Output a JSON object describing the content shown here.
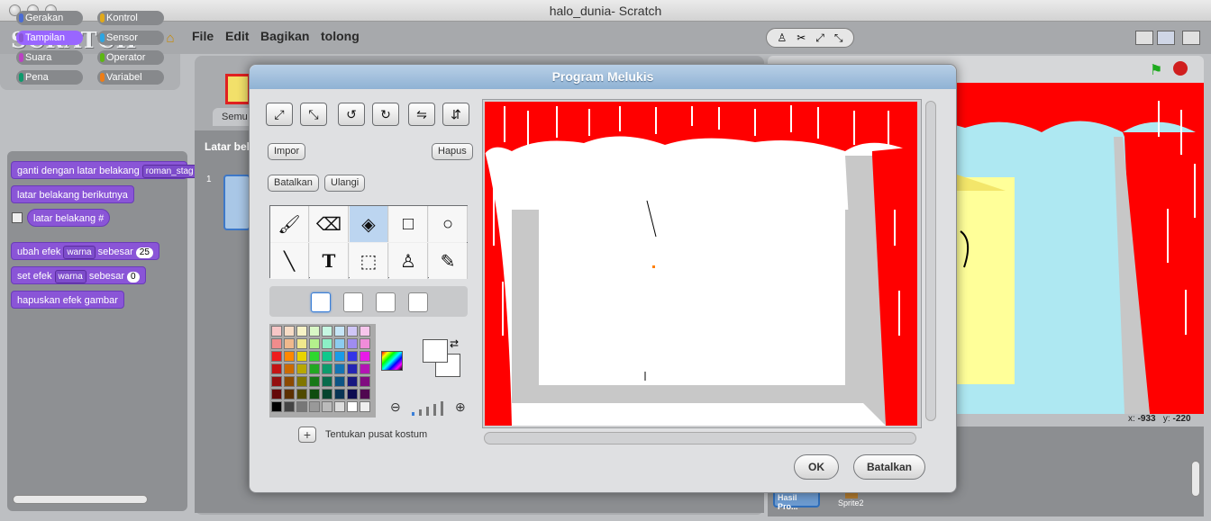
{
  "window": {
    "title": "halo_dunia- Scratch"
  },
  "app": {
    "logo": "SCRATCH",
    "menus": [
      "File",
      "Edit",
      "Bagikan",
      "tolong"
    ]
  },
  "categories": [
    {
      "label": "Gerakan",
      "color": "#4a6cd4"
    },
    {
      "label": "Kontrol",
      "color": "#e1a91a"
    },
    {
      "label": "Tampilan",
      "color": "#8a55d7",
      "active": true
    },
    {
      "label": "Sensor",
      "color": "#2ca5e2"
    },
    {
      "label": "Suara",
      "color": "#bb42c3"
    },
    {
      "label": "Operator",
      "color": "#5cb712"
    },
    {
      "label": "Pena",
      "color": "#0e9a6c"
    },
    {
      "label": "Variabel",
      "color": "#ee7d16"
    }
  ],
  "blocks": {
    "b1_label": "ganti dengan latar belakang",
    "b1_value": "roman_stag",
    "b2_label": "latar belakang berikutnya",
    "b3_label": "latar belakang #",
    "b4_label": "ubah efek",
    "b4_effect": "warna",
    "b4_mid": "sebesar",
    "b4_value": "25",
    "b5_label": "set efek",
    "b5_effect": "warna",
    "b5_mid": "sebesar",
    "b5_value": "0",
    "b6_label": "hapuskan efek gambar"
  },
  "middle": {
    "tab_label": "Semu",
    "section_label": "Latar bela",
    "item_number": "1"
  },
  "stage": {
    "x_label": "x:",
    "x_value": "-933",
    "y_label": "y:",
    "y_value": "-220"
  },
  "sprites": {
    "item1": "Hasil Pro...",
    "item2": "Sprite2"
  },
  "dialog": {
    "title": "Program Melukis",
    "import": "Impor",
    "clear": "Hapus",
    "undo": "Batalkan",
    "redo": "Ulangi",
    "set_center": "Tentukan pusat kostum",
    "ok": "OK",
    "cancel": "Batalkan"
  },
  "palette": [
    "#f7c6c6",
    "#f7dcc6",
    "#f7f3c6",
    "#d9f7c6",
    "#c6f7e2",
    "#c6e6f7",
    "#cfc6f7",
    "#f7c6ec",
    "#f08c8c",
    "#f0b98c",
    "#f0e88c",
    "#b4f08c",
    "#8cf0c6",
    "#8cccf0",
    "#9f8cf0",
    "#f08cd9",
    "#ee1c1c",
    "#ff8800",
    "#e8d400",
    "#2ed82e",
    "#10c88c",
    "#1a9ce8",
    "#3434e8",
    "#e81ae8",
    "#c41414",
    "#cc6a00",
    "#b8a800",
    "#22a822",
    "#0c9c6c",
    "#1474b4",
    "#2424b4",
    "#b414b4",
    "#941010",
    "#8c4a00",
    "#807600",
    "#187818",
    "#086c4c",
    "#0c5484",
    "#181880",
    "#800c80",
    "#640808",
    "#5c3000",
    "#504a00",
    "#0e4c0e",
    "#04442e",
    "#083454",
    "#0c0c50",
    "#500850",
    "#000000",
    "#444444",
    "#777777",
    "#999999",
    "#bbbbbb",
    "#dddddd",
    "#ffffff",
    "#eeeeee"
  ]
}
